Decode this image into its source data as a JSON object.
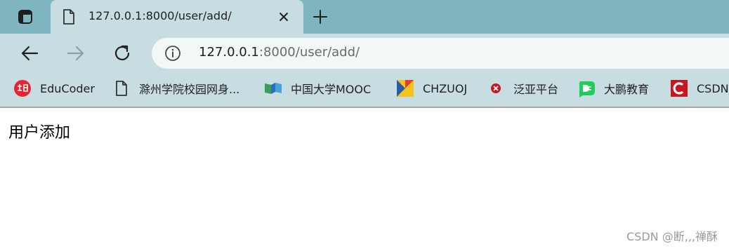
{
  "tab": {
    "title": "127.0.0.1:8000/user/add/"
  },
  "address_bar": {
    "host": "127.0.0.1",
    "path": ":8000/user/add/"
  },
  "bookmarks": [
    {
      "label": "EduCoder",
      "icon": "toutiao-icon"
    },
    {
      "label": "滁州学院校园网身...",
      "icon": "page-icon"
    },
    {
      "label": "中国大学MOOC",
      "icon": "mooc-icon"
    },
    {
      "label": "CHZUOJ",
      "icon": "chzuoj-icon"
    },
    {
      "label": "泛亚平台",
      "icon": "fanya-icon"
    },
    {
      "label": "大鹏教育",
      "icon": "dapeng-icon"
    },
    {
      "label": "CSDN",
      "icon": "csdn-icon"
    }
  ],
  "page": {
    "heading": "用户添加"
  },
  "watermark": "CSDN @断,,,禅酥",
  "colors": {
    "tabstrip": "#7fb6c0",
    "chrome": "#c7dde2",
    "addressbar": "#f2f7f8",
    "csdn_red": "#c8161e"
  }
}
